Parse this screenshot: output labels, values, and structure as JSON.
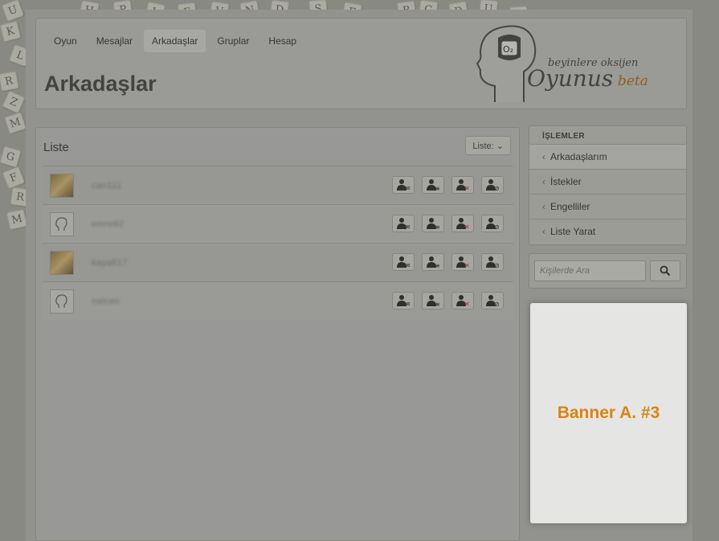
{
  "nav": {
    "items": [
      {
        "label": "Oyun",
        "active": false
      },
      {
        "label": "Mesajlar",
        "active": false
      },
      {
        "label": "Arkadaşlar",
        "active": true
      },
      {
        "label": "Gruplar",
        "active": false
      },
      {
        "label": "Hesap",
        "active": false
      }
    ]
  },
  "page_title": "Arkadaşlar",
  "logo": {
    "tagline": "beyinlere oksijen",
    "name": "Oyunus",
    "badge": "beta",
    "o2_label": "O₂"
  },
  "list": {
    "title": "Liste",
    "list_button": "Liste: ⌄",
    "rows": [
      {
        "username": "can111",
        "avatar": "photo-icon"
      },
      {
        "username": "emre92",
        "avatar": "default-avatar-icon"
      },
      {
        "username": "kaya617",
        "avatar": "photo-icon"
      },
      {
        "username": "nalcen",
        "avatar": "default-avatar-icon"
      }
    ]
  },
  "sidebar": {
    "heading": "İŞLEMLER",
    "items": [
      {
        "label": "Arkadaşlarım",
        "active": true
      },
      {
        "label": "İstekler",
        "active": false
      },
      {
        "label": "Engelliler",
        "active": false
      },
      {
        "label": "Liste Yarat",
        "active": false
      }
    ]
  },
  "search": {
    "placeholder": "Kişilerde Ara"
  },
  "banner": {
    "text": "Banner A. #3"
  },
  "colors": {
    "banner_text": "#f08a00",
    "beta": "#9a5a10"
  },
  "background_tiles": [
    "U",
    "H",
    "P",
    "L",
    "E",
    "V",
    "N",
    "D",
    "S",
    "F",
    "B",
    "C",
    "D",
    "U",
    "R",
    "K",
    "L",
    "R",
    "Z",
    "M",
    "G",
    "F",
    "R",
    "M",
    "P",
    "H",
    "U"
  ]
}
